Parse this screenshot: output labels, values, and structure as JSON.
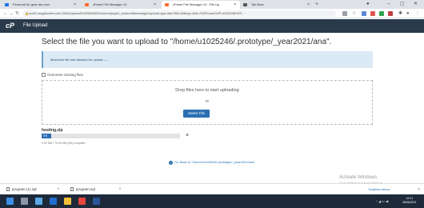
{
  "browser": {
    "tabs": [
      {
        "label": "Personal for gear.dev.com",
        "color": "#1a73e8",
        "active": false
      },
      {
        "label": "cPanel File Manager v3",
        "color": "#ff6c2c",
        "active": false
      },
      {
        "label": "cPanel File Manager v3 - File Up",
        "color": "#ff6c2c",
        "active": true
      },
      {
        "label": "Tab Bars",
        "color": "#555555",
        "active": false
      }
    ],
    "new_tab": "+",
    "url": "srv60.magahoster.com:2083/cpsess5162928402/frontend/paper_lantern/filemanager/upload-ajax.html?file=&fileop=&dir=%2Fhome%2Fu1025246%2F..."
  },
  "app": {
    "logo": "cP",
    "title": "File Upload"
  },
  "page": {
    "heading": "Select the file you want to upload to \"/home/u1025246/.prototype/_year2021/ana\".",
    "info": "Maximum file size allowed for upload: —",
    "overwrite_label": "Overwrite existing files",
    "drop_text": "Drop files here to start uploading",
    "or_text": "or",
    "select_button": "Select File",
    "upload": {
      "filename": "hosting.zip",
      "progress_label": "5%",
      "progress_pct": 5,
      "size_info": "2.92 MB / 70.63 MB (4%) complete",
      "cancel": "×"
    },
    "go_back": "Go Back to \"/home/u1025246/.prototype/_year2021/ana\""
  },
  "watermark": {
    "title": "Activate Windows",
    "subtitle": "Go to Settings to activate Windows."
  },
  "downloads": {
    "items": [
      "program (1).sql",
      "program.sql"
    ],
    "show_all": "Tampilkan semua",
    "close": "×"
  },
  "taskbar": {
    "time": "12:21",
    "date": "28/06/2021"
  }
}
